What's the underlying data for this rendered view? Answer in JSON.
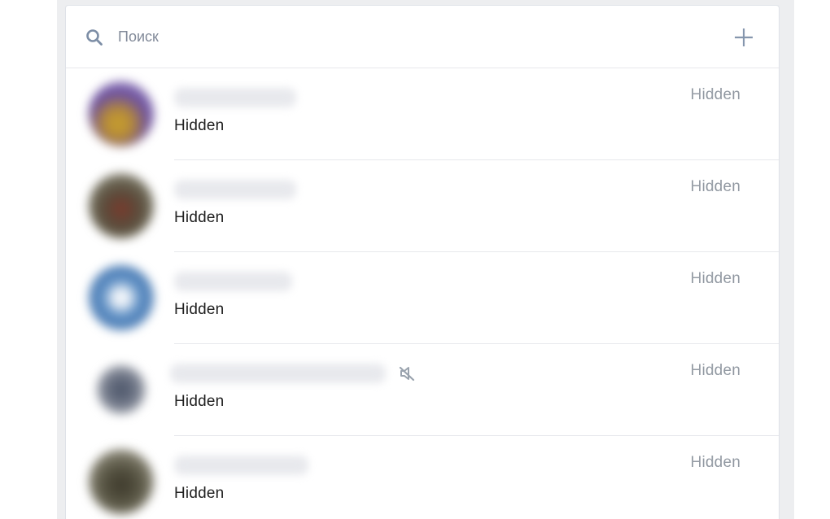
{
  "search": {
    "placeholder": "Поиск"
  },
  "icons": {
    "search": "search-icon",
    "add": "plus-icon",
    "mute": "muted-speaker-icon"
  },
  "colors": {
    "accent": "#5181b8",
    "icon": "#828a99",
    "date": "#939aa3",
    "text": "#222222",
    "divider": "#e7e8ec",
    "page_bg": "#edeef0"
  },
  "dialogs": [
    {
      "message": "Hidden",
      "date": "Hidden",
      "muted": false
    },
    {
      "message": "Hidden",
      "date": "Hidden",
      "muted": false
    },
    {
      "message": "Hidden",
      "date": "Hidden",
      "muted": false
    },
    {
      "message": "Hidden",
      "date": "Hidden",
      "muted": true
    },
    {
      "message": "Hidden",
      "date": "Hidden",
      "muted": false
    }
  ]
}
